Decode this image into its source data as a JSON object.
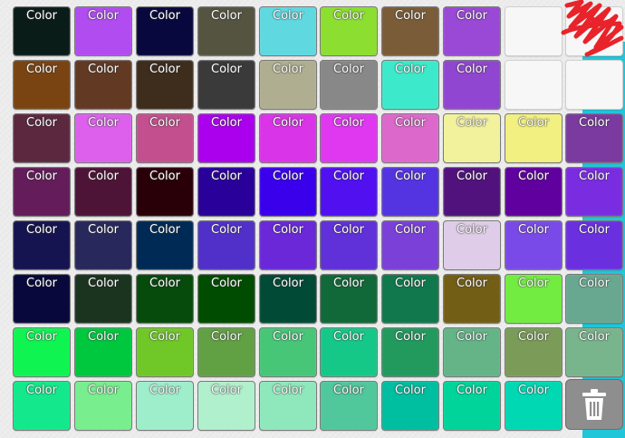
{
  "swatch_label": "Color",
  "palette": [
    [
      "#0a1c18",
      "#b04cf0",
      "#08083e",
      "#545440",
      "#60d8e0",
      "#8cde30",
      "#7a5c38",
      "#9a48d6",
      "#f7f7f7",
      "#f7f7f7"
    ],
    [
      "#7a4412",
      "#623a24",
      "#3e2c1c",
      "#3a3a3a",
      "#b0ae90",
      "#888888",
      "#3ceacb",
      "#9046d0",
      "#f7f7f7",
      "#f7f7f7"
    ],
    [
      "#5c2840",
      "#dc60ec",
      "#c44f8e",
      "#aa00ee",
      "#da34e8",
      "#df38f0",
      "#dd68cc",
      "#f2f29c",
      "#f1f080",
      "#7a3aa0"
    ],
    [
      "#641c5a",
      "#4e1438",
      "#2a0008",
      "#2a009a",
      "#3a00ec",
      "#5010f0",
      "#5434e0",
      "#52127e",
      "#60009e",
      "#7a2de0"
    ],
    [
      "#161450",
      "#28285c",
      "#002a56",
      "#5030c8",
      "#6a28d8",
      "#6030d8",
      "#7a40d8",
      "#decce8",
      "#7a4ae8",
      "#6a30e0"
    ],
    [
      "#08083c",
      "#1a3420",
      "#064a0c",
      "#004c00",
      "#014a36",
      "#116838",
      "#10784c",
      "#735e16",
      "#72ec40",
      "#69a890"
    ],
    [
      "#10f452",
      "#00c83e",
      "#70c828",
      "#62a044",
      "#48c678",
      "#16c888",
      "#229a5e",
      "#64b488",
      "#7a9c58",
      "#78b48c"
    ],
    [
      "#14e88c",
      "#78ee8e",
      "#9eeecc",
      "#b0f0cc",
      "#8ee8bc",
      "#50c89c",
      "#00bea0",
      "#00d49a",
      "#00d8b4",
      null
    ]
  ],
  "delete_button": {
    "icon": "trash-icon",
    "color": "#8e8e8e"
  },
  "accent": {
    "teal_panel": "#21c6d8",
    "scribble": "#e8232a"
  }
}
